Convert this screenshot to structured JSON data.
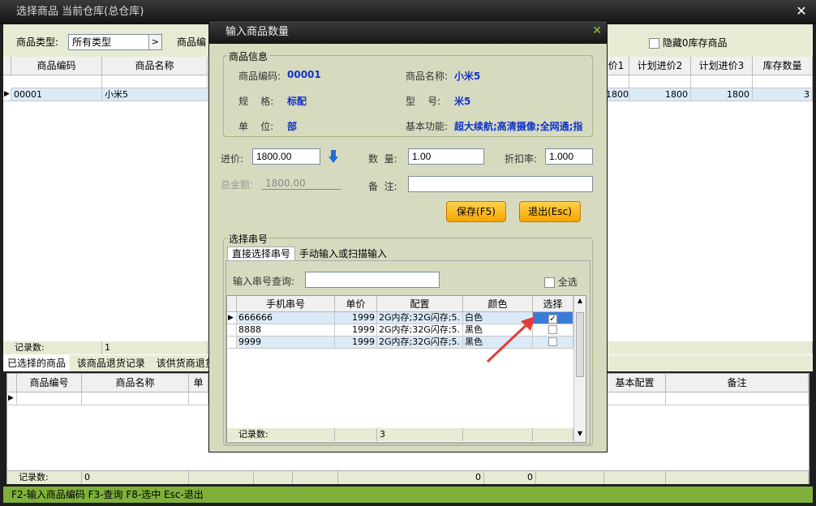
{
  "window": {
    "title": "选择商品 当前仓库(总仓库)",
    "close_glyph": "✕"
  },
  "filter": {
    "type_label": "商品类型:",
    "type_value": "所有类型",
    "code_label": "商品编",
    "hide_zero_label": "隐藏0库存商品"
  },
  "main_grid": {
    "columns_left": [
      "商品编码",
      "商品名称"
    ],
    "columns_right": [
      "价1",
      "计划进价2",
      "计划进价3",
      "库存数量"
    ],
    "row": {
      "code": "00001",
      "name": "小米5",
      "price1": "1800",
      "price2": "1800",
      "price3": "1800",
      "stock": "3"
    },
    "record_label": "记录数:",
    "record_count": "1"
  },
  "tabs": {
    "selected": "已选择的商品",
    "return_record": "该商品退货记录",
    "supplier_return": "该供货商退货"
  },
  "lower_grid": {
    "columns_left": [
      "商品编号",
      "商品名称",
      "单"
    ],
    "columns_right": [
      "基本配置",
      "备注"
    ],
    "record_label": "记录数:",
    "record_count": "0",
    "sum1": "0",
    "sum2": "0"
  },
  "status_text": "F2-输入商品编码 F3-查询 F8-选中 Esc-退出",
  "dialog": {
    "title": "输入商品数量",
    "close_glyph": "✕",
    "info_group": "商品信息",
    "code_label": "商品编码:",
    "code_value": "00001",
    "name_label": "商品名称:",
    "name_value": "小米5",
    "spec_label": "规    格:",
    "spec_value": "标配",
    "model_label": "型    号:",
    "model_value": "米5",
    "unit_label": "单    位:",
    "unit_value": "部",
    "func_label": "基本功能:",
    "func_value": "超大续航;高清摄像;全网通;指",
    "price_label": "进价:",
    "price_value": "1800.00",
    "qty_label": "数  量:",
    "qty_value": "1.00",
    "discount_label": "折扣率:",
    "discount_value": "1.000",
    "total_label": "总金额:",
    "total_value": "1800.00",
    "note_label": "备  注:",
    "note_value": "",
    "save_label": "保存(F5)",
    "exit_label": "退出(Esc)",
    "serial_group": "选择串号",
    "tab_direct": "直接选择串号",
    "tab_manual": "手动输入或扫描输入",
    "serial_query_label": "输入串号查询:",
    "serial_query_value": "",
    "select_all_label": "全选",
    "serial_columns": [
      "手机串号",
      "单价",
      "配置",
      "颜色",
      "选择"
    ],
    "serial_rows": [
      {
        "serial": "666666",
        "price": "1999",
        "config": "2G内存;32G闪存;5.",
        "color": "白色",
        "checked": true
      },
      {
        "serial": "8888",
        "price": "1999",
        "config": "2G内存;32G闪存;5.",
        "color": "黑色",
        "checked": false
      },
      {
        "serial": "9999",
        "price": "1999",
        "config": "2G内存;32G闪存;5.",
        "color": "黑色",
        "checked": false
      }
    ],
    "serial_record_label": "记录数:",
    "serial_record_count": "3"
  },
  "colors": {
    "accent_green": "#7fb03a",
    "dialog_bg": "#d6dbbf",
    "value_blue": "#1232c8",
    "arrow_red": "#e53a3a",
    "button_orange": "#f5a400"
  }
}
